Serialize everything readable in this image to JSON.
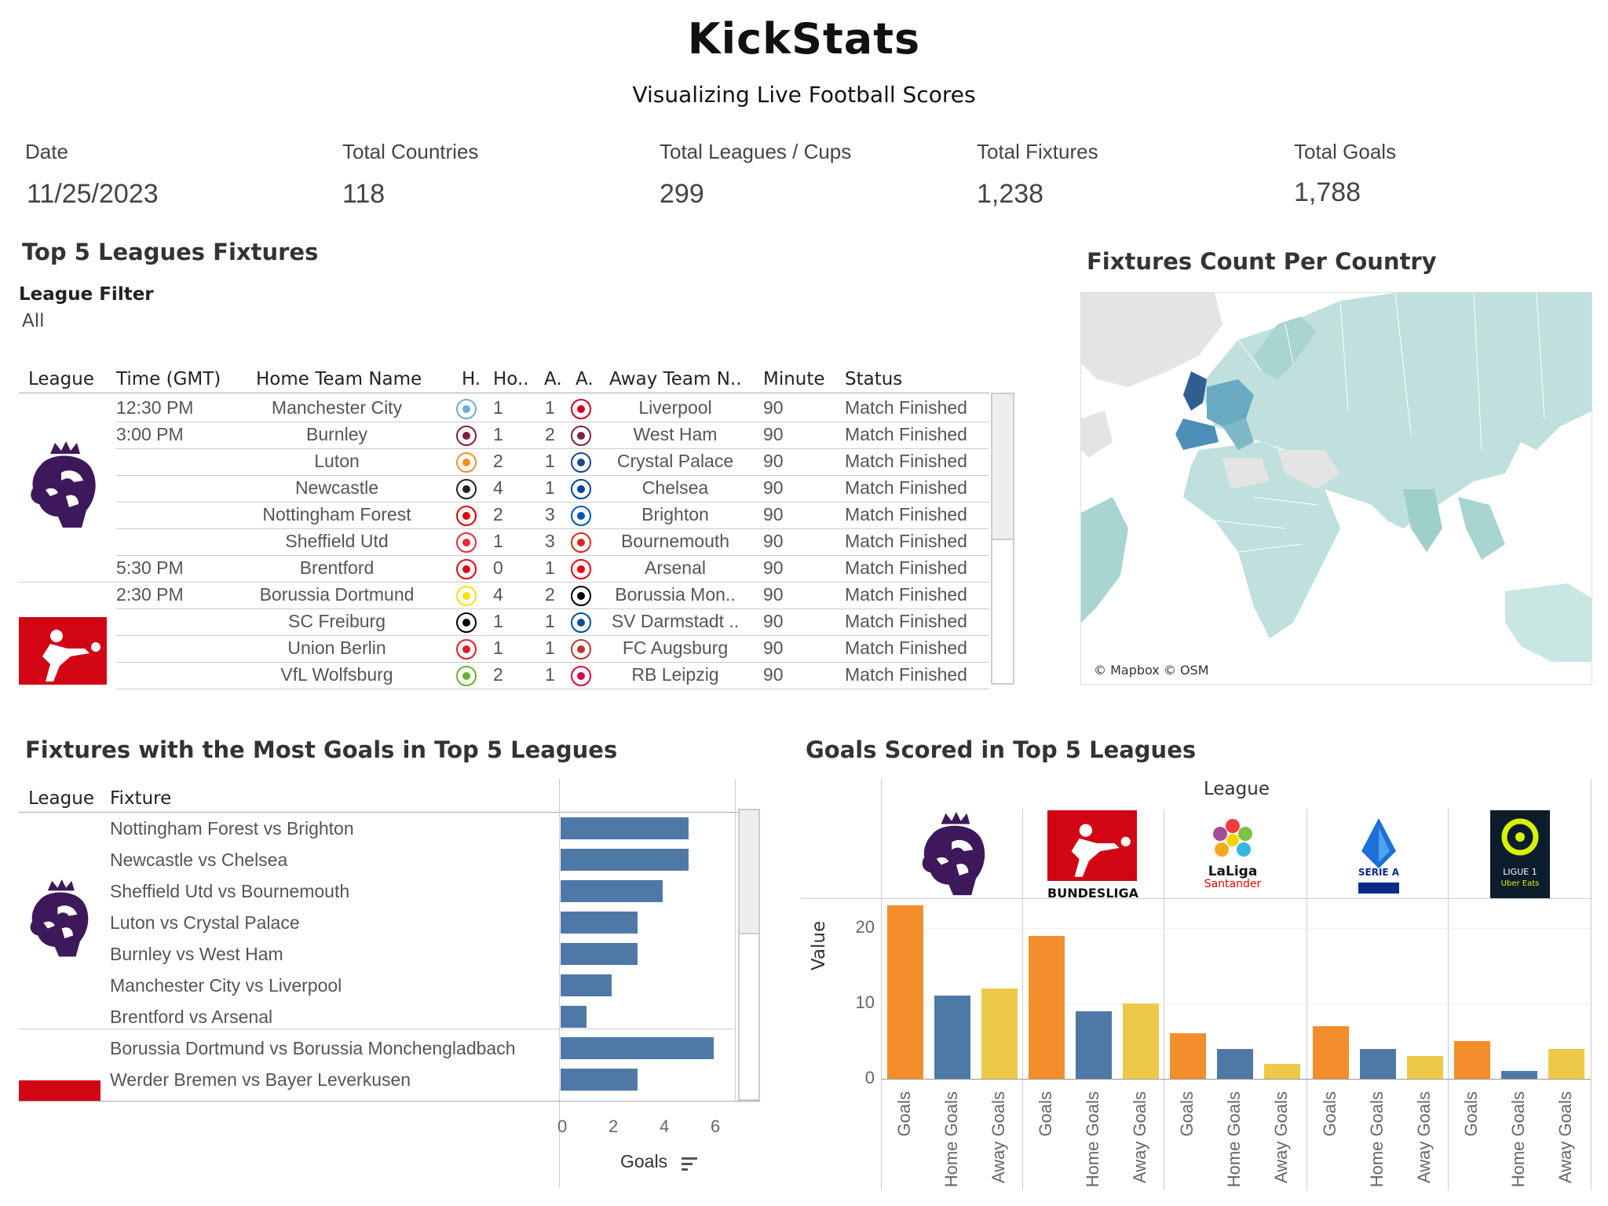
{
  "header": {
    "title": "KickStats",
    "subtitle": "Visualizing Live Football Scores"
  },
  "kpis": [
    {
      "label": "Date",
      "value": "11/25/2023"
    },
    {
      "label": "Total Countries",
      "value": "118"
    },
    {
      "label": "Total Leagues / Cups",
      "value": "299"
    },
    {
      "label": "Total Fixtures",
      "value": "1,238"
    },
    {
      "label": "Total Goals",
      "value": "1,788"
    }
  ],
  "fixtures_table": {
    "title": "Top 5 Leagues Fixtures",
    "filter_label": "League Filter",
    "filter_value": "All",
    "columns": [
      "League",
      "Time (GMT)",
      "Home Team Name",
      "H.",
      "Ho..",
      "A.",
      "A.",
      "Away Team N..",
      "Minute",
      "Status"
    ],
    "rows": [
      {
        "time": "12:30 PM",
        "home": "Manchester City",
        "hg": "1",
        "ag": "1",
        "away": "Liverpool",
        "minute": "90",
        "status": "Match Finished"
      },
      {
        "time": "3:00 PM",
        "home": "Burnley",
        "hg": "1",
        "ag": "2",
        "away": "West Ham",
        "minute": "90",
        "status": "Match Finished"
      },
      {
        "time": "",
        "home": "Luton",
        "hg": "2",
        "ag": "1",
        "away": "Crystal Palace",
        "minute": "90",
        "status": "Match Finished"
      },
      {
        "time": "",
        "home": "Newcastle",
        "hg": "4",
        "ag": "1",
        "away": "Chelsea",
        "minute": "90",
        "status": "Match Finished"
      },
      {
        "time": "",
        "home": "Nottingham Forest",
        "hg": "2",
        "ag": "3",
        "away": "Brighton",
        "minute": "90",
        "status": "Match Finished"
      },
      {
        "time": "",
        "home": "Sheffield Utd",
        "hg": "1",
        "ag": "3",
        "away": "Bournemouth",
        "minute": "90",
        "status": "Match Finished"
      },
      {
        "time": "5:30 PM",
        "home": "Brentford",
        "hg": "0",
        "ag": "1",
        "away": "Arsenal",
        "minute": "90",
        "status": "Match Finished"
      },
      {
        "time": "2:30 PM",
        "home": "Borussia Dortmund",
        "hg": "4",
        "ag": "2",
        "away": "Borussia Mon..",
        "minute": "90",
        "status": "Match Finished"
      },
      {
        "time": "",
        "home": "SC Freiburg",
        "hg": "1",
        "ag": "1",
        "away": "SV Darmstadt ..",
        "minute": "90",
        "status": "Match Finished"
      },
      {
        "time": "",
        "home": "Union Berlin",
        "hg": "1",
        "ag": "1",
        "away": "FC Augsburg",
        "minute": "90",
        "status": "Match Finished"
      },
      {
        "time": "",
        "home": "VfL Wolfsburg",
        "hg": "2",
        "ag": "1",
        "away": "RB Leipzig",
        "minute": "90",
        "status": "Match Finished"
      }
    ]
  },
  "map": {
    "title": "Fixtures Count Per Country",
    "attribution": "© Mapbox © OSM",
    "land_color": "#bfe0dc",
    "highlight_color": "#3b73a8"
  },
  "most_goals": {
    "title": "Fixtures with the Most Goals in Top 5 Leagues",
    "col_league": "League",
    "col_fixture": "Fixture",
    "axis_label": "Goals",
    "ticks": [
      "0",
      "2",
      "4",
      "6"
    ],
    "bar_color": "#4e79a7",
    "chart_data": {
      "type": "bar",
      "categories": [
        "Nottingham Forest vs Brighton",
        "Newcastle vs Chelsea",
        "Sheffield Utd vs Bournemouth",
        "Luton vs Crystal Palace",
        "Burnley vs West Ham",
        "Manchester City vs Liverpool",
        "Brentford vs Arsenal",
        "Borussia Dortmund vs Borussia Monchengladbach",
        "Werder Bremen vs Bayer Leverkusen"
      ],
      "values": [
        5,
        5,
        4,
        3,
        3,
        2,
        1,
        6,
        3
      ],
      "xlabel": "Goals",
      "xlim": [
        0,
        7
      ]
    }
  },
  "goals_scored": {
    "title": "Goals Scored in Top 5 Leagues",
    "header": "League",
    "ylabel": "Value",
    "ticks": [
      "0",
      "10",
      "20"
    ],
    "logos": {
      "bundesliga": "BUNDESLIGA",
      "laliga": "LaLiga",
      "laliga_sponsor": "Santander",
      "seriea": "SERIE A",
      "ligue1": "LIGUE 1",
      "ligue1_sponsor": "Uber Eats"
    },
    "colors": {
      "Goals": "#f28e2b",
      "Home Goals": "#4e79a7",
      "Away Goals": "#edc948"
    },
    "chart_data": {
      "type": "bar",
      "categories": [
        "Goals",
        "Home Goals",
        "Away Goals"
      ],
      "series": [
        {
          "values": [
            23,
            11,
            12
          ]
        },
        {
          "values": [
            19,
            9,
            10
          ]
        },
        {
          "values": [
            6,
            4,
            2
          ]
        },
        {
          "values": [
            7,
            4,
            3
          ]
        },
        {
          "values": [
            5,
            1,
            4
          ]
        }
      ],
      "ylabel": "Value",
      "ylim": [
        0,
        24
      ]
    }
  }
}
